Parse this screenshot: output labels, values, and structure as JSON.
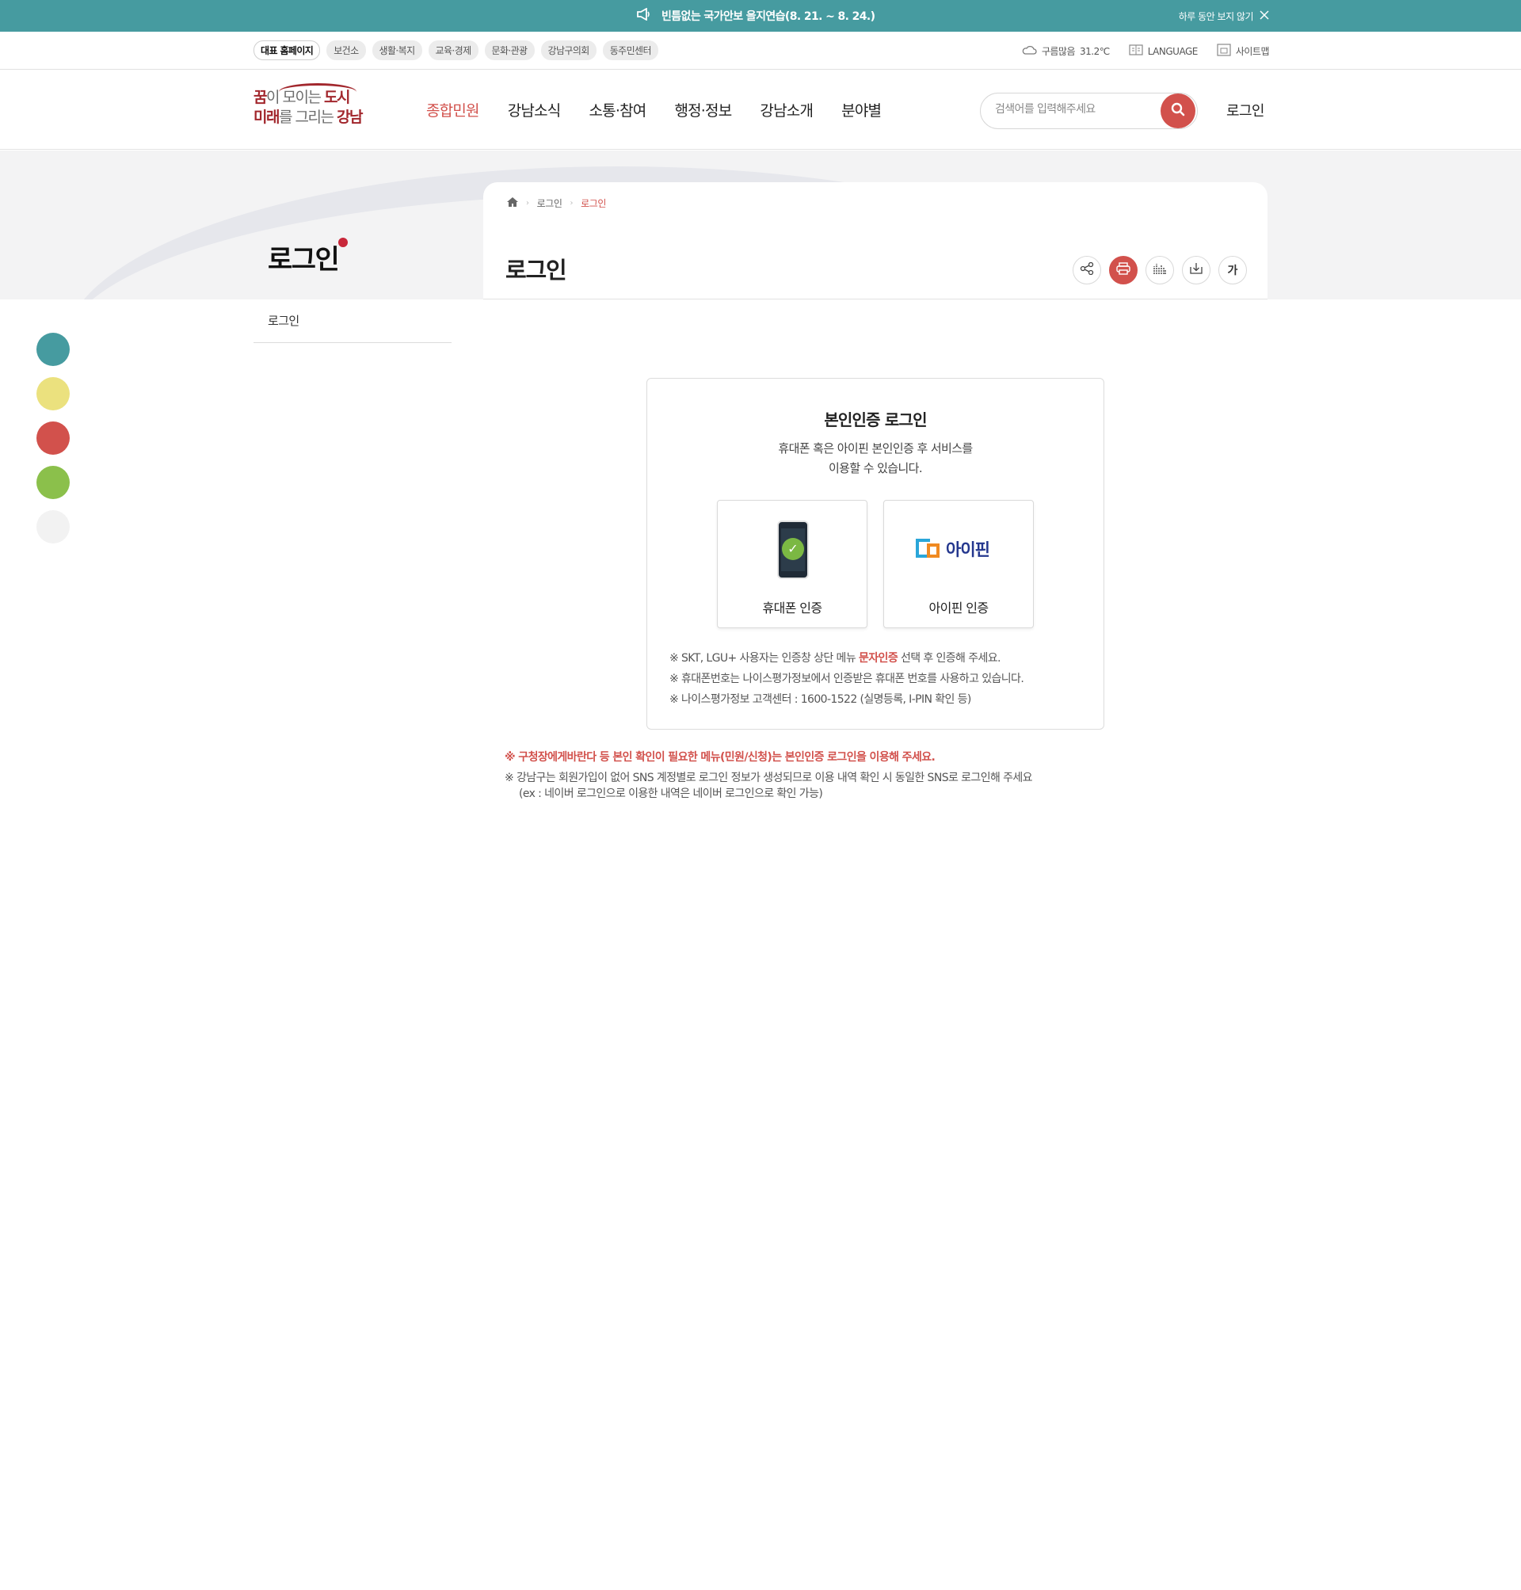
{
  "announcement": {
    "text": "빈틈없는 국가안보 을지연습(8. 21. ~ 8. 24.)",
    "close_label": "하루 동안 보지 않기"
  },
  "site_links": [
    "대표 홈페이지",
    "보건소",
    "생활·복지",
    "교육·경제",
    "문화·관광",
    "강남구의회",
    "동주민센터"
  ],
  "utility": {
    "weather_label": "구름많음",
    "temperature": "31.2℃",
    "language_label": "LANGUAGE",
    "sitemap_label": "사이트맵"
  },
  "logo": {
    "line1_a": "꿈",
    "line1_b": "이 모이는 ",
    "line1_c": "도시",
    "line2_a": "미래",
    "line2_b": "를 그리는 ",
    "line2_c": "강남"
  },
  "gnb": [
    "종합민원",
    "강남소식",
    "소통·참여",
    "행정·정보",
    "강남소개",
    "분야별"
  ],
  "search": {
    "placeholder": "검색어를 입력해주세요"
  },
  "header_login": "로그인",
  "side": {
    "title": "로그인",
    "menu_item": "로그인"
  },
  "breadcrumb": [
    "로그인",
    "로그인"
  ],
  "page_title": "로그인",
  "tools": {
    "font_label": "가"
  },
  "color_dots": [
    "#469ba0",
    "#ebe17e",
    "#d2514c",
    "#8bc04b",
    "#f2f2f2"
  ],
  "login_box": {
    "title": "본인인증 로그인",
    "desc_line1": "휴대폰 혹은 아이핀 본인인증 후 서비스를",
    "desc_line2": "이용할 수 있습니다.",
    "phone_label": "휴대폰 인증",
    "ipin_label": "아이핀 인증",
    "ipin_logo_text": "아이핀",
    "note1_a": "※ SKT, LGU+ 사용자는 인증창 상단 메뉴 ",
    "note1_hl": "문자인증",
    "note1_b": " 선택 후 인증해 주세요.",
    "note2": "※ 휴대폰번호는 나이스평가정보에서 인증받은 휴대폰 번호를 사용하고 있습니다.",
    "note3": "※ 나이스평가정보 고객센터 : 1600-1522 (실명등록, I-PIN 확인 등)"
  },
  "bottom_notes": {
    "red": "※ 구청장에게바란다 등 본인 확인이 필요한 메뉴(민원/신청)는 본인인증 로그인을 이용해 주세요.",
    "gray1": "※ 강남구는 회원가입이 없어 SNS 계정별로 로그인 정보가 생성되므로 이용 내역 확인 시 동일한 SNS로 로그인해 주세요",
    "gray2": "(ex : 네이버 로그인으로 이용한 내역은 네이버 로그인으로 확인 가능)"
  }
}
